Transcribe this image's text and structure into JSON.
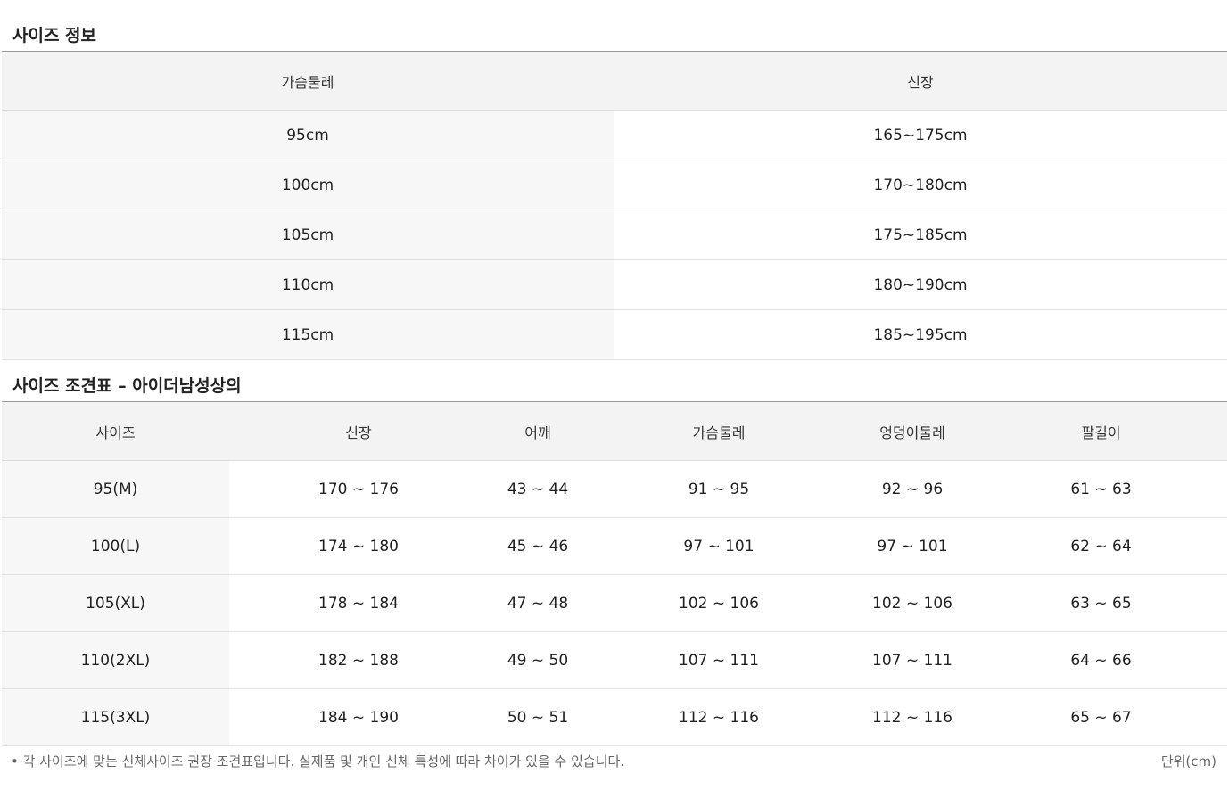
{
  "size_info": {
    "title": "사이즈 정보",
    "headers": [
      "가슴둘레",
      "신장"
    ],
    "rows": [
      [
        "95cm",
        "165~175cm"
      ],
      [
        "100cm",
        "170~180cm"
      ],
      [
        "105cm",
        "175~185cm"
      ],
      [
        "110cm",
        "180~190cm"
      ],
      [
        "115cm",
        "185~195cm"
      ]
    ]
  },
  "size_chart": {
    "title": "사이즈 조견표 – 아이더남성상의",
    "headers": [
      "사이즈",
      "신장",
      "어깨",
      "가슴둘레",
      "엉덩이둘레",
      "팔길이"
    ],
    "rows": [
      [
        "95(M)",
        "170 ~ 176",
        "43 ~ 44",
        "91 ~ 95",
        "92 ~ 96",
        "61 ~ 63"
      ],
      [
        "100(L)",
        "174 ~ 180",
        "45 ~ 46",
        "97 ~ 101",
        "97 ~ 101",
        "62 ~ 64"
      ],
      [
        "105(XL)",
        "178 ~ 184",
        "47 ~ 48",
        "102 ~ 106",
        "102 ~ 106",
        "63 ~ 65"
      ],
      [
        "110(2XL)",
        "182 ~ 188",
        "49 ~ 50",
        "107 ~ 111",
        "107 ~ 111",
        "64 ~ 66"
      ],
      [
        "115(3XL)",
        "184 ~ 190",
        "50 ~ 51",
        "112 ~ 116",
        "112 ~ 116",
        "65 ~ 67"
      ]
    ]
  },
  "footer": {
    "note": "•  각 사이즈에 맞는 신체사이즈 권장 조견표입니다. 실제품 및 개인 신체 특성에 따라 차이가 있을 수 있습니다.",
    "unit": "단위(cm)"
  }
}
